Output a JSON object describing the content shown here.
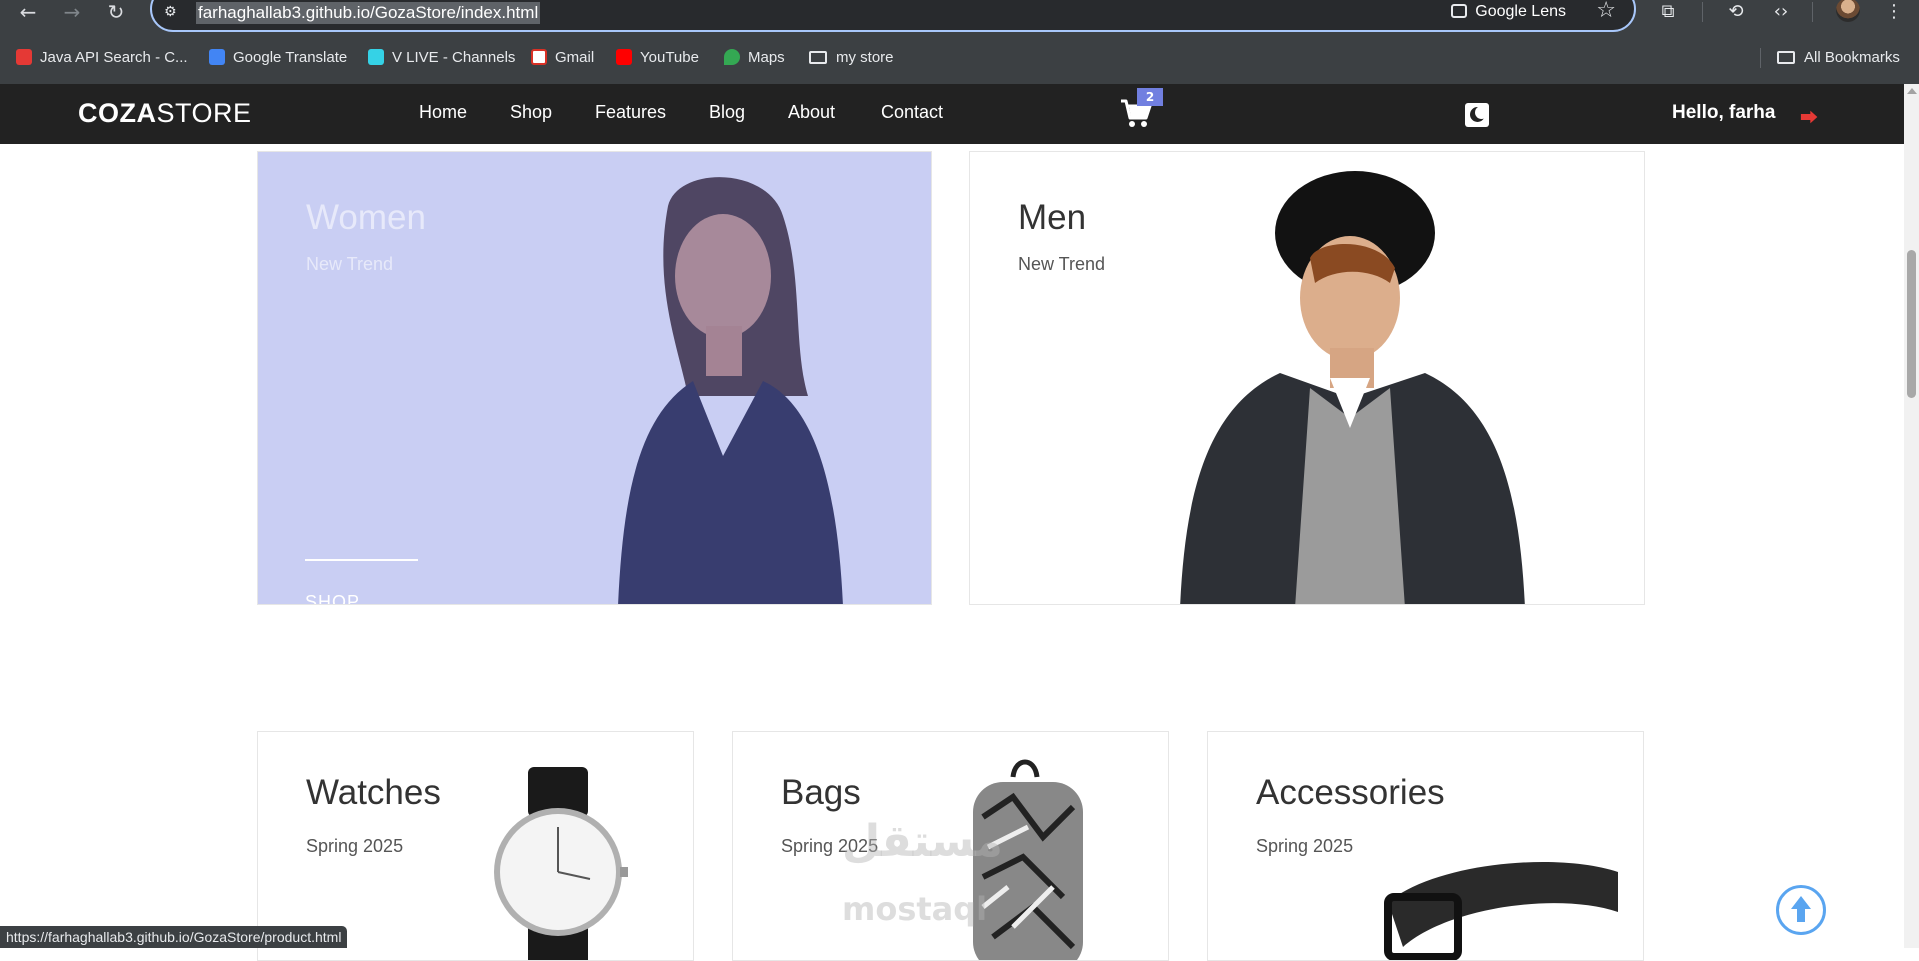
{
  "browser": {
    "url": "farhaghallab3.github.io/GozaStore/index.html",
    "lens_label": "Google Lens",
    "bookmarks": [
      {
        "label": "Java API Search - C...",
        "icon": "java-icon"
      },
      {
        "label": "Google Translate",
        "icon": "translate-icon"
      },
      {
        "label": "V LIVE - Channels",
        "icon": "vlive-icon"
      },
      {
        "label": "Gmail",
        "icon": "gmail-icon"
      },
      {
        "label": "YouTube",
        "icon": "youtube-icon"
      },
      {
        "label": "Maps",
        "icon": "maps-icon"
      },
      {
        "label": "my store",
        "icon": "folder-icon"
      }
    ],
    "all_bookmarks": "All Bookmarks",
    "status_url": "https://farhaghallab3.github.io/GozaStore/product.html"
  },
  "site": {
    "logo_bold": "COZA",
    "logo_light": "STORE",
    "nav": [
      "Home",
      "Shop",
      "Features",
      "Blog",
      "About",
      "Contact"
    ],
    "cart_count": "2",
    "greeting": "Hello, farha",
    "accent_color": "#717fe0"
  },
  "banners": {
    "women": {
      "title": "Women",
      "subtitle": "New Trend",
      "cta": "SHOP"
    },
    "men": {
      "title": "Men",
      "subtitle": "New Trend"
    },
    "watches": {
      "title": "Watches",
      "subtitle": "Spring 2025"
    },
    "bags": {
      "title": "Bags",
      "subtitle": "Spring 2025"
    },
    "accessories": {
      "title": "Accessories",
      "subtitle": "Spring 2025"
    }
  },
  "watermark": {
    "arabic": "مستقل",
    "latin": "mostaql"
  }
}
